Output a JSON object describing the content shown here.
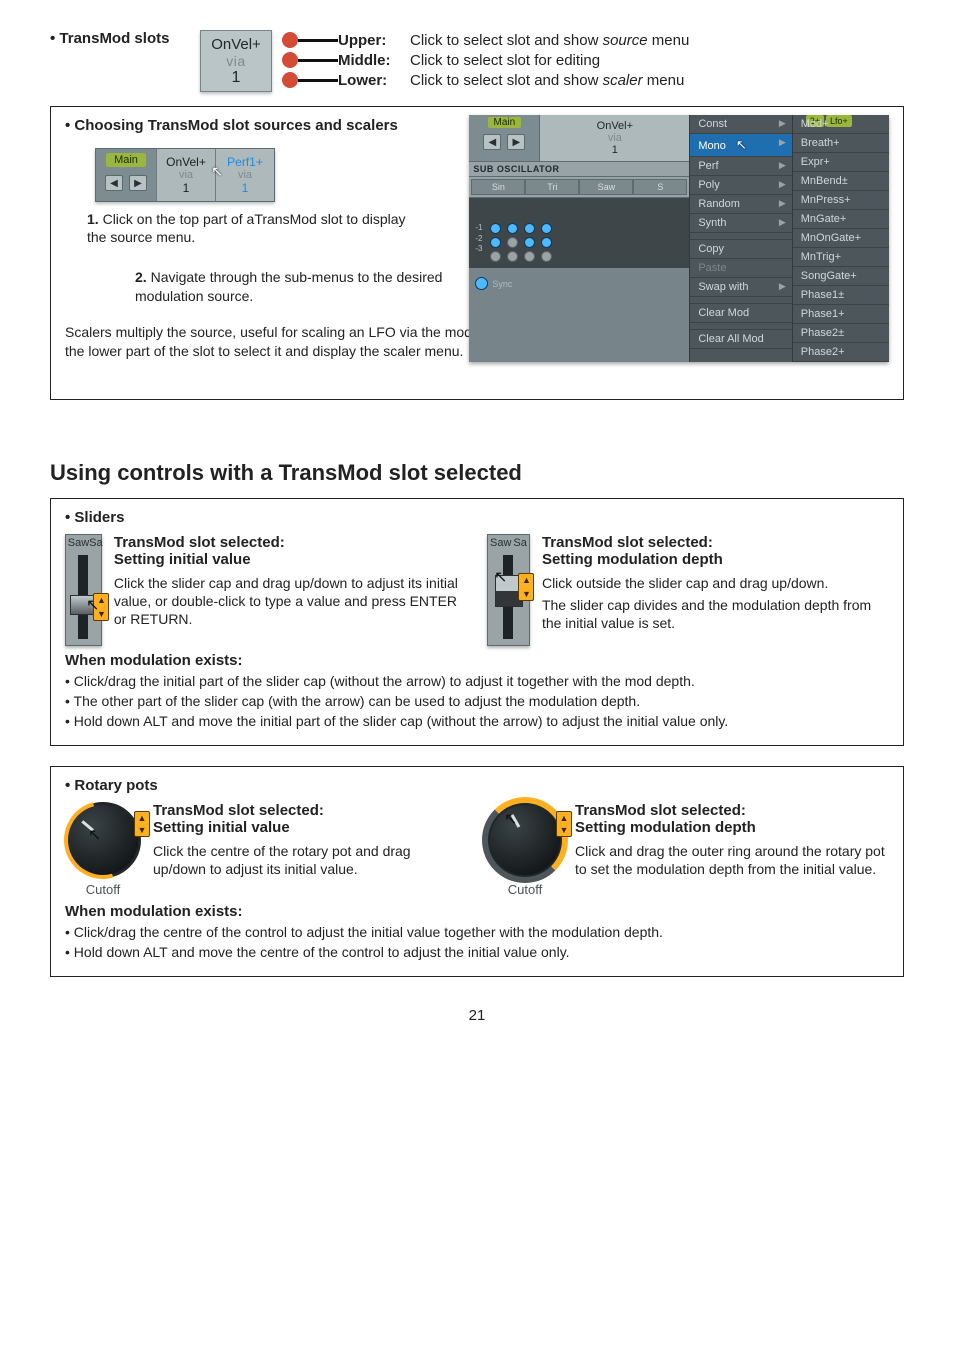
{
  "header": {
    "title": "TransMod slots",
    "slot_top": "OnVel+",
    "slot_mid": "via",
    "slot_bot": "1",
    "rows": [
      {
        "label": "Upper:",
        "text_pre": "Click to select slot and show ",
        "em": "source",
        "text_post": " menu"
      },
      {
        "label": "Middle:",
        "text_pre": "Click to select slot for editing",
        "em": "",
        "text_post": ""
      },
      {
        "label": "Lower:",
        "text_pre": "Click to select slot and show ",
        "em": "scaler",
        "text_post": " menu"
      }
    ]
  },
  "box1": {
    "title": "Choosing TransMod slot sources and scalers",
    "mini": {
      "main_lbl": "Main",
      "slot1_top": "OnVel+",
      "slot1_mid": "via",
      "slot1_bot": "1",
      "slot2_top": "Perf1+",
      "slot2_mid": "via",
      "slot2_bot": "1"
    },
    "step1_num": "1.",
    "step1_txt": "Click on the top part of aTransMod slot to display the source menu.",
    "step2_num": "2.",
    "step2_txt": "Navigate through the sub-menus to the desired modulation source.",
    "footer": "Scalers multiply the source, useful for scaling an LFO via the mod wheel, for example. They are selected in the same way – click on the lower part of the slot to select it and display the scaler menu."
  },
  "menu": {
    "main_lbl": "Main",
    "slot_top": "OnVel+",
    "slot_mid": "via",
    "slot_bot": "1",
    "subosc": "SUB OSCILLATOR",
    "waves": [
      "Sin",
      "Tri",
      "Saw",
      "S"
    ],
    "nums": [
      "-1",
      "-2",
      "-3"
    ],
    "sync": "Sync",
    "col1": [
      "Const",
      "Mono",
      "Perf",
      "Poly",
      "Random",
      "Synth",
      "",
      "Copy",
      "Paste",
      "Swap with",
      "",
      "Clear Mod",
      "",
      "Clear All Mod"
    ],
    "col1_sel_index": 1,
    "col1_arrow": [
      0,
      1,
      2,
      3,
      4,
      5,
      9
    ],
    "col1_dim": [
      8
    ],
    "col2": [
      "Mod+",
      "Breath+",
      "Expr+",
      "MnBend±",
      "MnPress+",
      "MnGate+",
      "MnOnGate+",
      "MnTrig+",
      "SongGate+",
      "Phase1±",
      "Phase1+",
      "Phase2±",
      "Phase2+"
    ],
    "tiny_chips": [
      "2+",
      "Lfo+"
    ]
  },
  "section_heading": "Using controls with a TransMod slot selected",
  "sliders": {
    "title": "Sliders",
    "left_heading1": "TransMod slot selected:",
    "left_heading2": "Setting initial value",
    "left_body": "Click the slider cap and drag up/down to adjust its initial value, or double-click to type a value and press ENTER or RETURN.",
    "right_heading1": "TransMod slot selected:",
    "right_heading2": "Setting modulation depth",
    "right_body1": "Click outside the slider cap and drag up/down.",
    "right_body2": "The slider cap divides and the modulation depth from the initial value is set.",
    "when_heading": "When modulation exists:",
    "when_list": [
      "Click/drag the initial part of the slider cap (without the arrow) to adjust it together with the mod depth.",
      "The other part of the slider cap (with the arrow) can be used to adjust the modulation depth.",
      "Hold down ALT and move the initial part of the slider cap (without the arrow) to adjust the initial value only."
    ],
    "demo_lbls": {
      "l": "Saw",
      "r": "Sa"
    }
  },
  "pots": {
    "title": "Rotary pots",
    "left_heading1": "TransMod slot selected:",
    "left_heading2": "Setting initial value",
    "left_body": "Click the centre of the rotary pot and drag up/down to adjust its initial value.",
    "right_heading1": "TransMod slot selected:",
    "right_heading2": "Setting modulation depth",
    "right_body": "Click and drag the outer ring around the rotary pot to set the modulation depth from the initial value.",
    "when_heading": "When modulation exists:",
    "when_list": [
      "Click/drag the centre of the control to adjust the initial value together with the modulation depth.",
      "Hold down ALT and move the centre of the control to adjust the initial value only."
    ],
    "pot_lbl": "Cutoff"
  },
  "page_number": "21"
}
